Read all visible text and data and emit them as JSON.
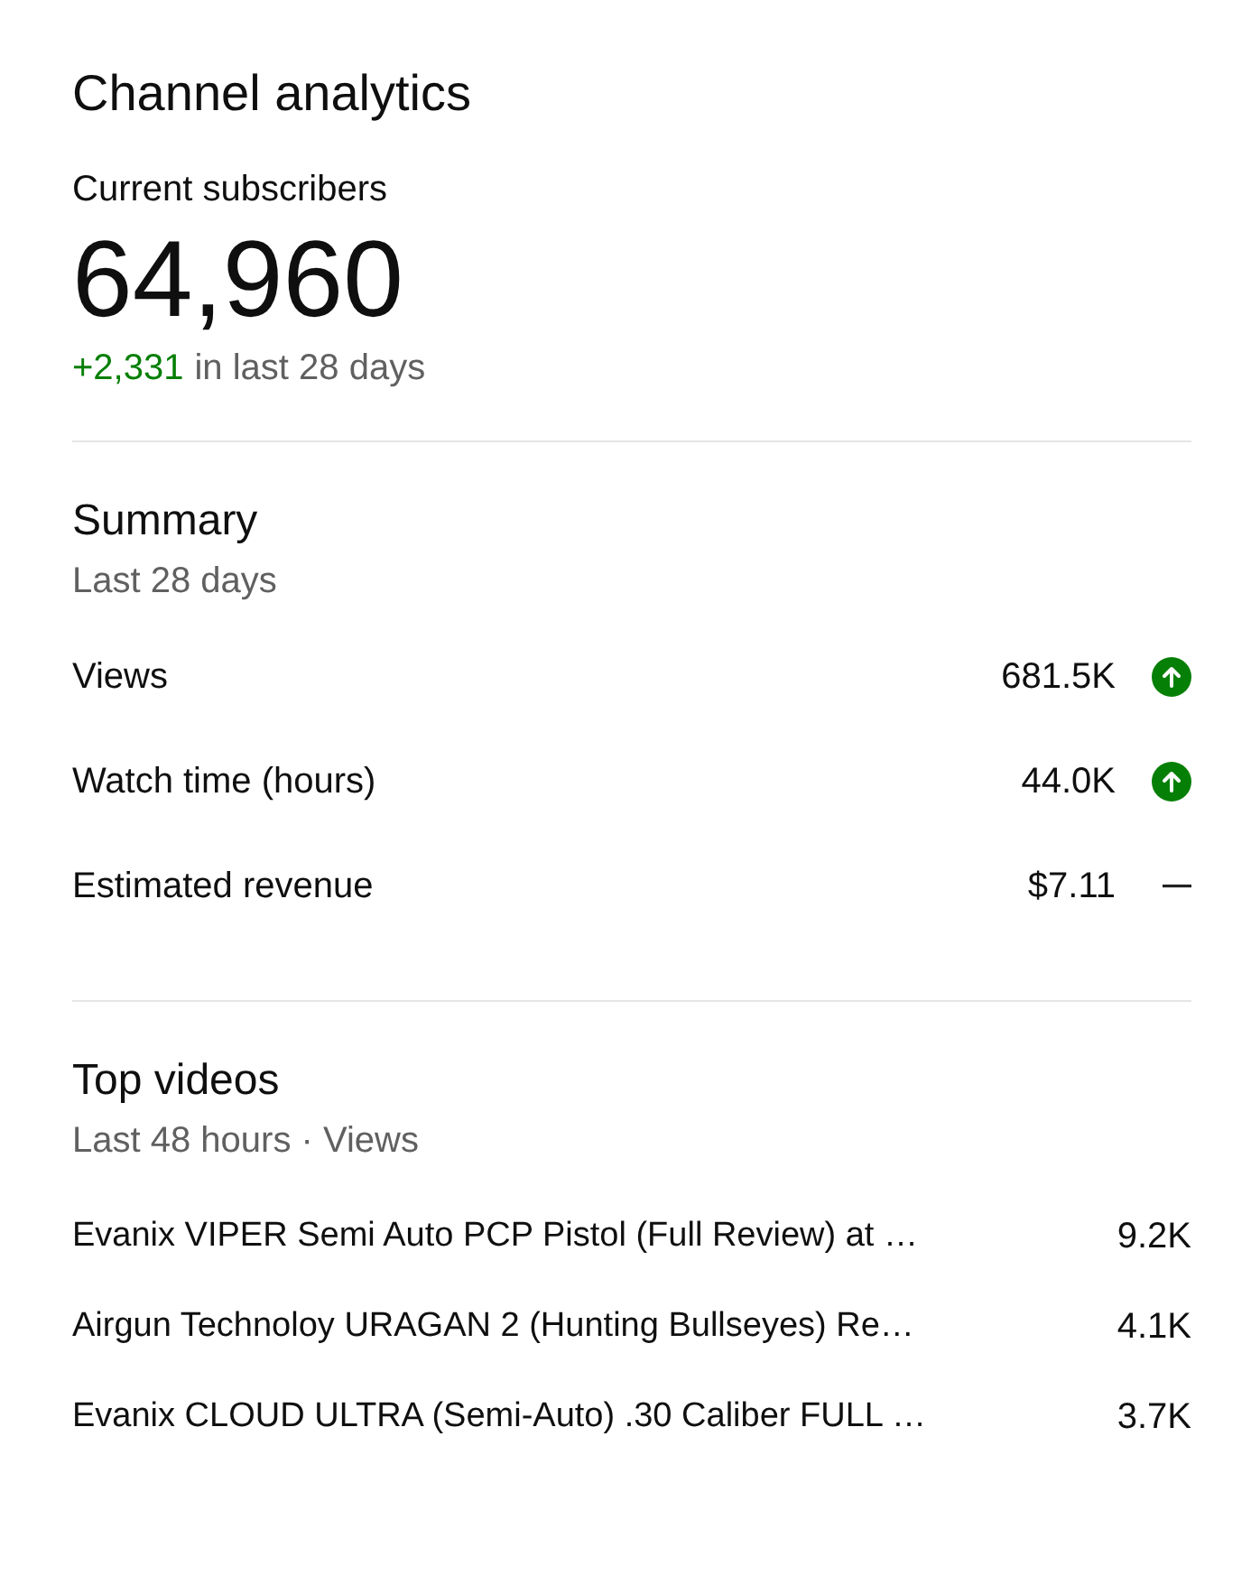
{
  "title": "Channel analytics",
  "subscribers": {
    "label": "Current subscribers",
    "count": "64,960",
    "change": "+2,331",
    "change_period": "in last 28 days"
  },
  "summary": {
    "title": "Summary",
    "period": "Last 28 days",
    "metrics": [
      {
        "label": "Views",
        "value": "681.5K",
        "kind": "up"
      },
      {
        "label": "Watch time (hours)",
        "value": "44.0K",
        "kind": "up"
      },
      {
        "label": "Estimated revenue",
        "value": "$7.11",
        "kind": "flat"
      }
    ]
  },
  "top_videos": {
    "title": "Top videos",
    "period": "Last 48 hours · Views",
    "videos": [
      {
        "title": "Evanix VIPER Semi Auto PCP Pistol (Full Review) at …",
        "views": "9.2K"
      },
      {
        "title": "Airgun Technoloy URAGAN 2 (Hunting Bullseyes) Re…",
        "views": "4.1K"
      },
      {
        "title": "Evanix CLOUD ULTRA (Semi-Auto) .30 Caliber FULL …",
        "views": "3.7K"
      }
    ]
  }
}
